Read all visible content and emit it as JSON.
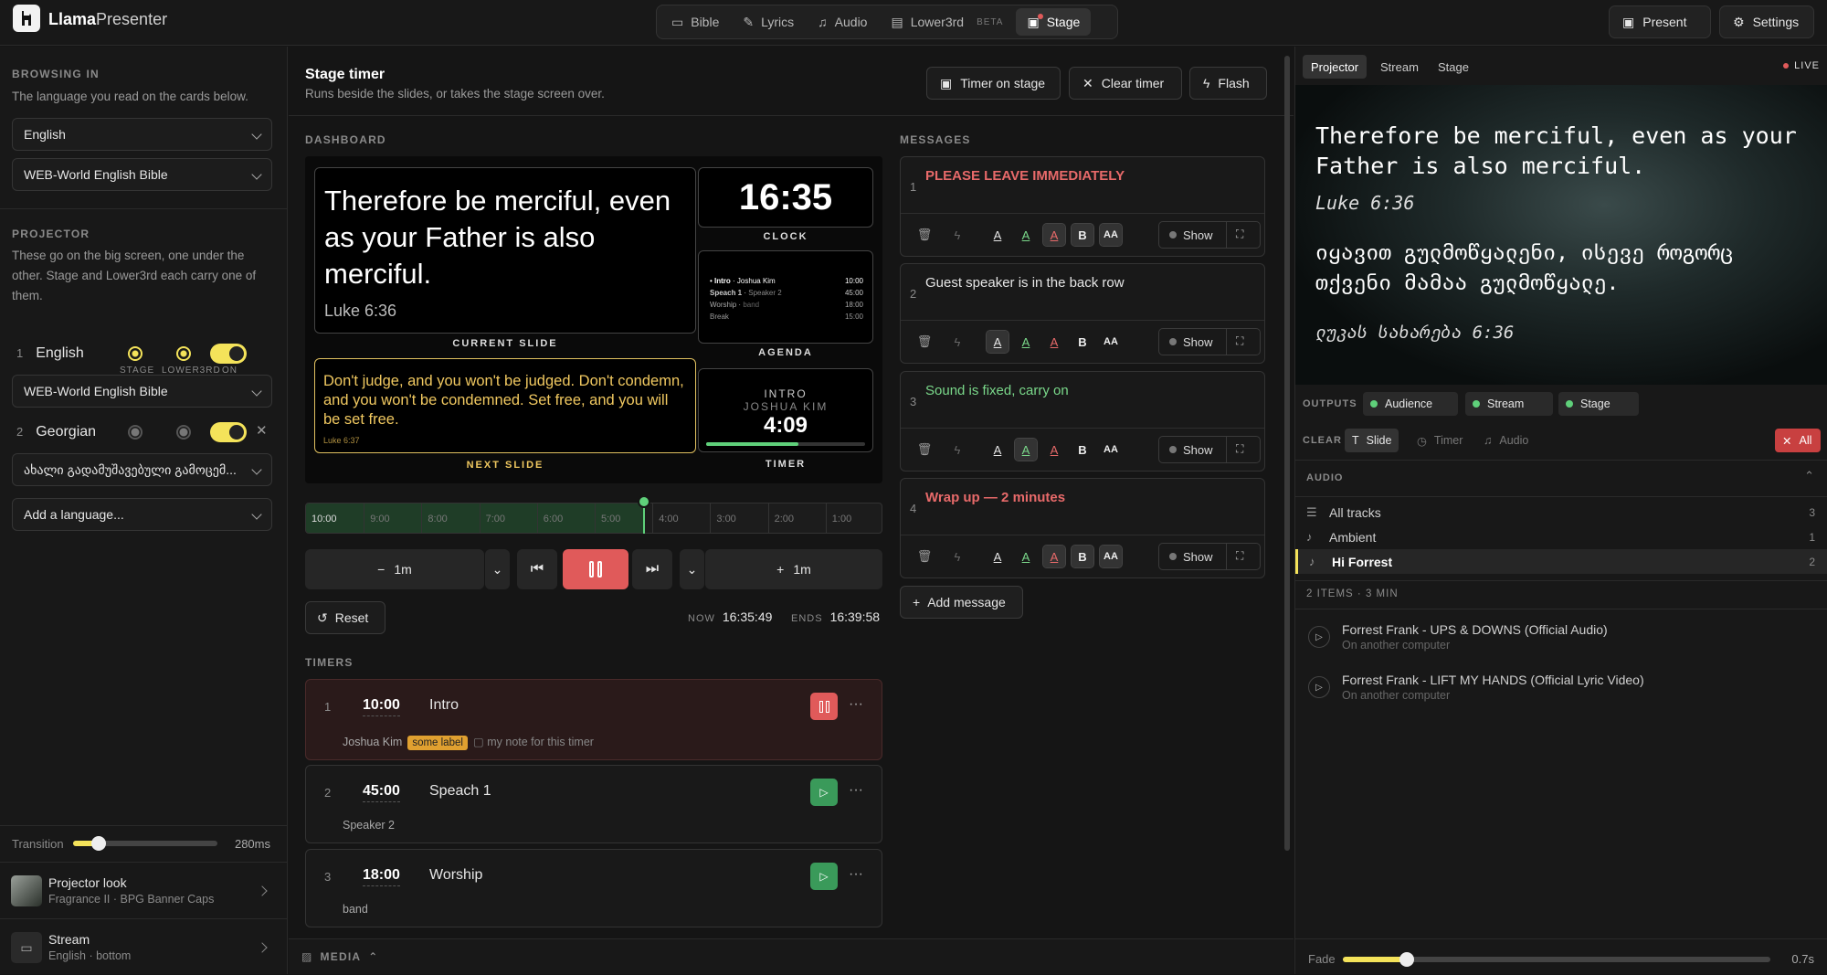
{
  "app": {
    "brand_bold": "Llama",
    "brand_light": "Presenter"
  },
  "nav": {
    "tabs": [
      {
        "label": "Bible",
        "icon": "book-icon"
      },
      {
        "label": "Lyrics",
        "icon": "feather-icon"
      },
      {
        "label": "Audio",
        "icon": "music-icon"
      },
      {
        "label": "Lower3rd",
        "icon": "lower-third-icon",
        "badge": "BETA"
      },
      {
        "label": "Stage",
        "icon": "monitor-icon"
      }
    ],
    "present": "Present",
    "settings": "Settings"
  },
  "sidebar": {
    "browsing_header": "BROWSING IN",
    "browsing_desc": "The language you read on the cards below.",
    "browse_language": "English",
    "browse_bible": "WEB-World English Bible",
    "projector_header": "PROJECTOR",
    "projector_desc": "These go on the big screen, one under the other. Stage and Lower3rd each carry one of them.",
    "col_stage": "STAGE",
    "col_lower3rd": "LOWER3RD",
    "col_on": "ON",
    "languages": [
      {
        "n": "1",
        "name": "English",
        "bible": "WEB-World English Bible"
      },
      {
        "n": "2",
        "name": "Georgian",
        "bible": "ახალი გადამუშავებული გამოცემ..."
      }
    ],
    "add_language": "Add a language...",
    "transition_label": "Transition",
    "transition_value": "280ms",
    "transition_fraction": 0.18,
    "projector_look_title": "Projector look",
    "projector_look_sub": "Fragrance II · BPG Banner Caps",
    "stream_title": "Stream",
    "stream_sub": "English · bottom"
  },
  "stage": {
    "title": "Stage timer",
    "subtitle": "Runs beside the slides, or takes the stage screen over.",
    "timer_on_stage": "Timer on stage",
    "clear_timer": "Clear timer",
    "flash": "Flash",
    "dashboard_header": "DASHBOARD",
    "current_slide_text": "Therefore be merciful, even as your Father is also merciful.",
    "current_slide_ref": "Luke 6:36",
    "current_slide_caption": "CURRENT SLIDE",
    "clock": "16:35",
    "clock_caption": "CLOCK",
    "agenda": [
      {
        "name": "Intro",
        "who": "Joshua Kim",
        "time": "10:00"
      },
      {
        "name": "Speach 1",
        "who": "Speaker 2",
        "time": "45:00"
      },
      {
        "name": "Worship",
        "who": "band",
        "time": "18:00"
      },
      {
        "name": "Break",
        "who": "",
        "time": "15:00"
      }
    ],
    "agenda_caption": "AGENDA",
    "next_slide_text": "Don't judge, and you won't be judged. Don't condemn, and you won't be condemned. Set free, and you will be set free.",
    "next_slide_ref": "Luke 6:37",
    "next_slide_caption": "NEXT SLIDE",
    "timer_title": "INTRO",
    "timer_who": "JOSHUA KIM",
    "timer_value": "4:09",
    "timer_progress": 0.58,
    "timer_caption": "TIMER",
    "timeline_ticks": [
      "10:00",
      "9:00",
      "8:00",
      "7:00",
      "6:00",
      "5:00",
      "4:00",
      "3:00",
      "2:00",
      "1:00"
    ],
    "timeline_progress": 0.585,
    "minus_label": "1m",
    "plus_label": "1m",
    "reset": "Reset",
    "now_label": "NOW",
    "now_value": "16:35:49",
    "ends_label": "ENDS",
    "ends_value": "16:39:58",
    "timers_header": "TIMERS",
    "timers": [
      {
        "n": "1",
        "time": "10:00",
        "name": "Intro",
        "who": "Joshua Kim",
        "label": "some label",
        "note": "my note for this timer",
        "running": true
      },
      {
        "n": "2",
        "time": "45:00",
        "name": "Speach 1",
        "who": "Speaker 2",
        "running": false
      },
      {
        "n": "3",
        "time": "18:00",
        "name": "Worship",
        "who": "band",
        "running": false
      }
    ],
    "messages_header": "MESSAGES",
    "messages": [
      {
        "n": "1",
        "text": "PLEASE LEAVE IMMEDIATELY",
        "color": "#e86a6a",
        "bold": true,
        "show": "Show"
      },
      {
        "n": "2",
        "text": "Guest speaker is in the back row",
        "color": "#e6e6e6",
        "bold": false,
        "show": "Show"
      },
      {
        "n": "3",
        "text": "Sound is fixed, carry on",
        "color": "#7ad88a",
        "bold": false,
        "show": "Show"
      },
      {
        "n": "4",
        "text": "Wrap up — 2 minutes",
        "color": "#e86a6a",
        "bold": true,
        "show": "Show"
      }
    ],
    "add_message": "Add message",
    "media_label": "MEDIA"
  },
  "right": {
    "tabs": [
      "Projector",
      "Stream",
      "Stage"
    ],
    "live": "LIVE",
    "preview_en": "Therefore be merciful, even as your Father is also merciful.",
    "preview_en_ref": "Luke 6:36",
    "preview_ka": "იყავით გულმოწყალენი, ისევე როგორც თქვენი მამაა გულმოწყალე.",
    "preview_ka_ref": "ლუკას სახარება 6:36",
    "outputs_label": "OUTPUTS",
    "outputs": [
      "Audience",
      "Stream",
      "Stage"
    ],
    "clear_label": "CLEAR",
    "clear_slide": "Slide",
    "clear_timer": "Timer",
    "clear_audio": "Audio",
    "clear_all": "All",
    "audio_header": "AUDIO",
    "audio_lists": [
      {
        "name": "All tracks",
        "count": "3"
      },
      {
        "name": "Ambient",
        "count": "1"
      },
      {
        "name": "Hi Forrest",
        "count": "2"
      }
    ],
    "items_summary": "2 ITEMS · 3 MIN",
    "tracks": [
      {
        "title": "Forrest Frank - UPS & DOWNS (Official Audio)",
        "sub": "On another computer"
      },
      {
        "title": "Forrest Frank - LIFT MY HANDS (Official Lyric Video)",
        "sub": "On another computer"
      }
    ],
    "fade_label": "Fade",
    "fade_value": "0.7s",
    "fade_fraction": 0.15
  }
}
